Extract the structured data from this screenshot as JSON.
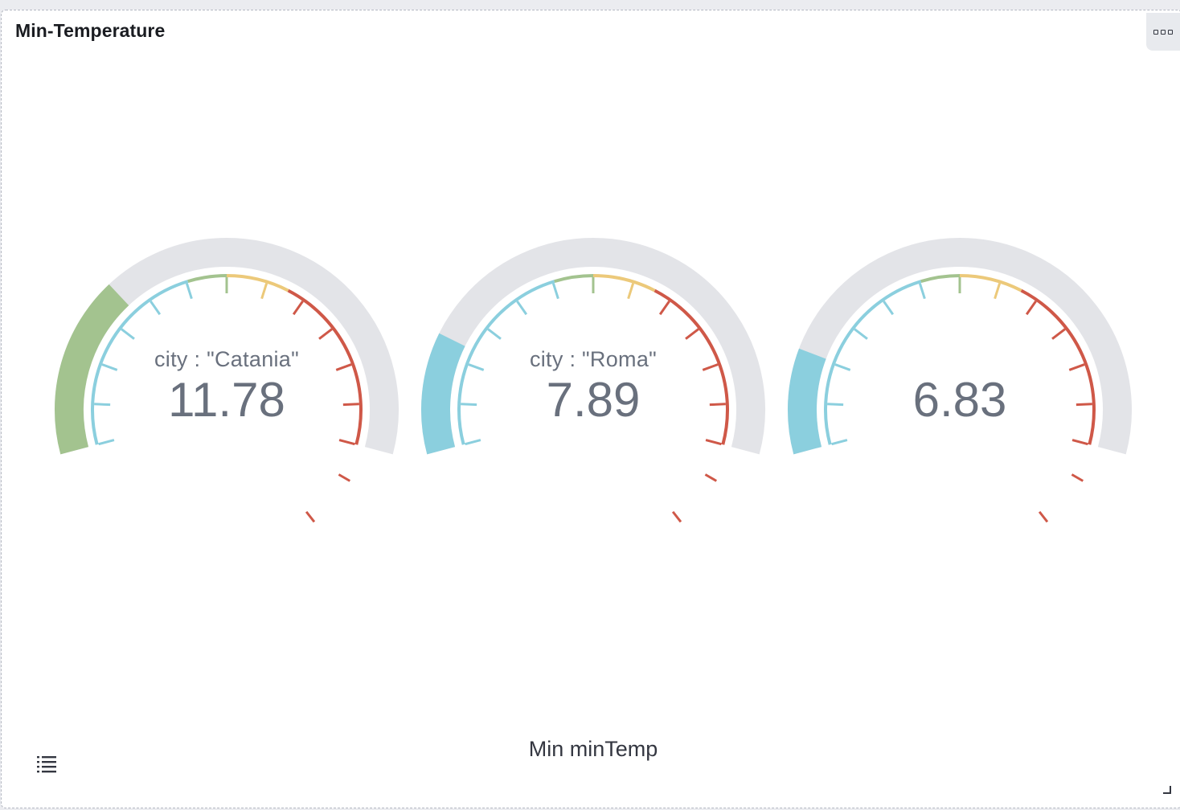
{
  "panel": {
    "title": "Min-Temperature",
    "options_icon": "three-dots-icon",
    "legend_icon": "list-icon",
    "resize_icon": "resize-corner-icon"
  },
  "chart_data": {
    "type": "gauge",
    "xlabel": "Min minTemp",
    "series": [
      {
        "label": "city : \"Catania\"",
        "value": 11.78,
        "value_text": "11.78",
        "fill_color": "#a3c38f"
      },
      {
        "label": "city : \"Roma\"",
        "value": 7.89,
        "value_text": "7.89",
        "fill_color": "#8bcfde"
      },
      {
        "label": "",
        "value": 6.83,
        "value_text": "6.83",
        "fill_color": "#8bcfde"
      }
    ],
    "color_ranges": [
      "#8bcfde",
      "#a3c38f",
      "#ecc97a",
      "#cf5848"
    ],
    "background_arc_color": "#e3e4e8"
  }
}
